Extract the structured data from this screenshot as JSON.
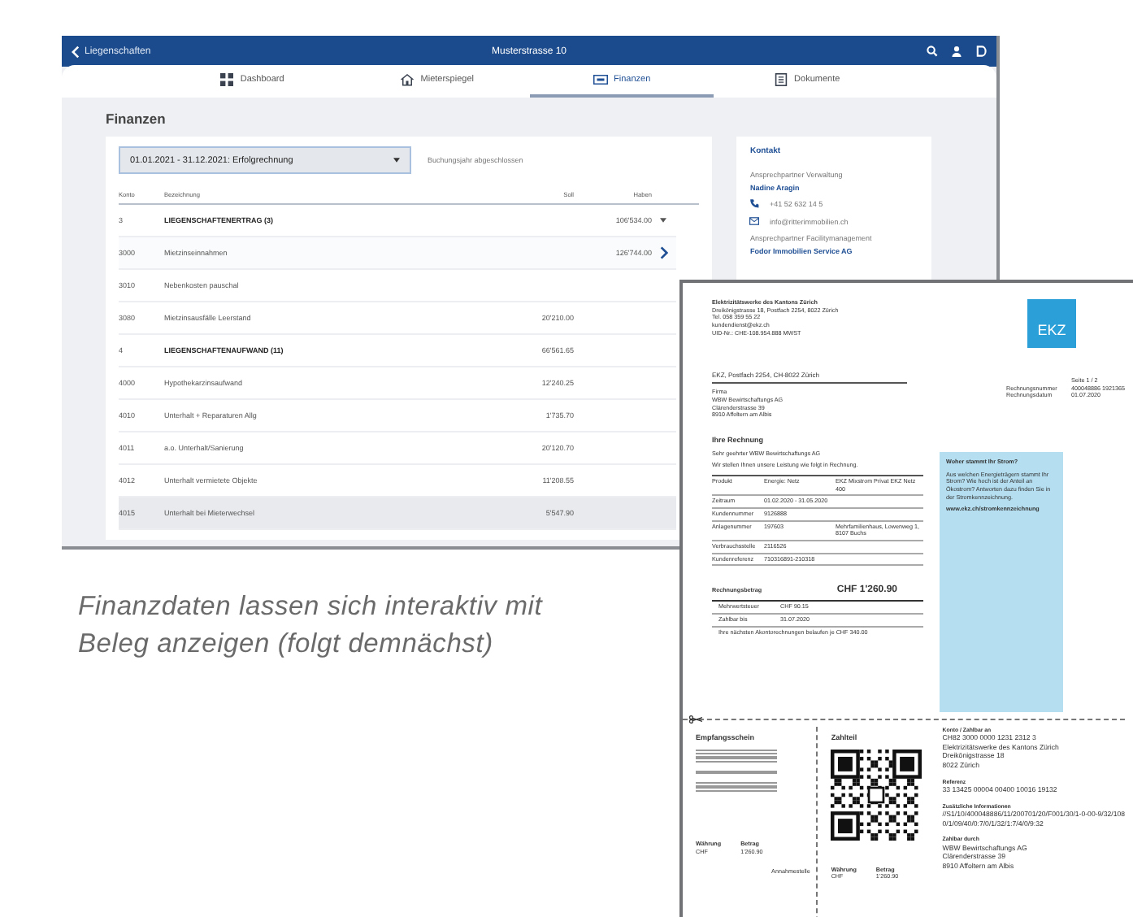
{
  "app": {
    "header": {
      "back_label": "Liegenschaften",
      "title": "Musterstrasse 10"
    },
    "tabs": [
      {
        "label": "Dashboard",
        "selected": false
      },
      {
        "label": "Mieterspiegel",
        "selected": false
      },
      {
        "label": "Finanzen",
        "selected": true
      },
      {
        "label": "Dokumente",
        "selected": false
      }
    ],
    "section_title": "Finanzen",
    "period_select": {
      "value": "01.01.2021 - 31.12.2021: Erfolgrechnung"
    },
    "period_status": "Buchungsjahr abgeschlossen",
    "table": {
      "columns": [
        "Konto",
        "Bezeichnung",
        "Soll",
        "Haben"
      ],
      "rows": [
        {
          "kind": "group",
          "konto": "3",
          "name": "LIEGENSCHAFTENERTRAG (3)",
          "soll": "",
          "haben": "106'534.00",
          "expanded": true,
          "selected": false,
          "hovered": false
        },
        {
          "kind": "account",
          "konto": "3000",
          "name": "Mietzinseinnahmen",
          "soll": "",
          "haben": "126'744.00",
          "selected": false,
          "hovered": true
        },
        {
          "kind": "account",
          "konto": "3010",
          "name": "Nebenkosten pauschal",
          "soll": "",
          "haben": "",
          "selected": false,
          "hovered": false
        },
        {
          "kind": "account",
          "konto": "3080",
          "name": "Mietzinsausfälle Leerstand",
          "soll": "20'210.00",
          "haben": "",
          "selected": false,
          "hovered": false
        },
        {
          "kind": "group",
          "konto": "4",
          "name": "LIEGENSCHAFTENAUFWAND (11)",
          "soll": "66'561.65",
          "haben": "",
          "selected": false,
          "hovered": false
        },
        {
          "kind": "account",
          "konto": "4000",
          "name": "Hypothekarzinsaufwand",
          "soll": "12'240.25",
          "haben": "",
          "selected": false,
          "hovered": false
        },
        {
          "kind": "account",
          "konto": "4010",
          "name": "Unterhalt + Reparaturen Allg",
          "soll": "1'735.70",
          "haben": "",
          "selected": false,
          "hovered": false
        },
        {
          "kind": "account",
          "konto": "4011",
          "name": "a.o. Unterhalt/Sanierung",
          "soll": "20'120.70",
          "haben": "",
          "selected": false,
          "hovered": false
        },
        {
          "kind": "account",
          "konto": "4012",
          "name": "Unterhalt vermietete Objekte",
          "soll": "11'208.55",
          "haben": "",
          "selected": false,
          "hovered": false
        },
        {
          "kind": "account",
          "konto": "4015",
          "name": "Unterhalt bei Mieterwechsel",
          "soll": "5'547.90",
          "haben": "",
          "selected": true,
          "hovered": false
        }
      ]
    },
    "contact": {
      "title": "Kontakt",
      "groups": [
        {
          "role": "Ansprechpartner Verwaltung",
          "name": "Nadine Aragin",
          "phone": "+41 52 632 14 5",
          "email": "info@ritterimmobilien.ch"
        },
        {
          "role": "Ansprechpartner Facilitymanagement",
          "name": "Fodor Immobilien Service AG"
        }
      ]
    }
  },
  "caption": "Finanzdaten lassen sich interaktiv mit Beleg anzeigen (folgt demnächst)",
  "invoice": {
    "sender": [
      "Elektrizitätswerke des Kantons Zürich",
      "Dreikönigstrasse 18, Postfach 2254, 8022 Zürich",
      "Tel. 058 359 55 22",
      "kundendienst@ekz.ch",
      "UID-Nr.: CHE-108.954.888 MWST"
    ],
    "logo": "EKZ",
    "return_address": "EKZ, Postfach 2254, CH-8022 Zürich",
    "recipient": [
      "Firma",
      "WBW Bewirtschaftungs AG",
      "Clärenderstrasse 39",
      "8910 Affoltern am Albis"
    ],
    "meta": [
      {
        "value": "Seite 1 / 2"
      },
      {
        "label": "Rechnungsnummer",
        "value": "400048886 1921365"
      },
      {
        "label": "Rechnungsdatum",
        "value": "01.07.2020"
      }
    ],
    "heading": "Ihre Rechnung",
    "salutation": "Sehr geehrter WBW Bewirtschaftungs AG",
    "intro": "Wir stellen Ihnen unsere Leistung wie folgt in Rechnung.",
    "details": [
      {
        "label": "Produkt",
        "value": "Energie: Netz",
        "extra": "EKZ Mixstrom Privat EKZ Netz 400"
      },
      {
        "label": "Zeitraum",
        "value": "01.02.2020 - 31.05.2020"
      },
      {
        "label": "Kundennummer",
        "value": "9126888"
      },
      {
        "label": "Anlagenummer",
        "value": "197603",
        "extra": "Mehrfamilienhaus, Lowenweg 1, 8107 Buchs"
      },
      {
        "label": "Verbrauchsstelle",
        "value": "2116526"
      },
      {
        "label": "Kundenreferenz",
        "value": "710316891-210318"
      }
    ],
    "info_box": {
      "title": "Woher stammt Ihr Strom?",
      "text": "Aus welchen Energieträgern stammt Ihr Strom? Wie hoch ist der Anteil an Ökostrom? Antworten dazu finden Sie in der Stromkennzeichnung.",
      "link": "www.ekz.ch/stromkennzeichnung"
    },
    "total_label": "Rechnungsbetrag",
    "total": "CHF 1'260.90",
    "summary": [
      {
        "label": "Mehrwertsteuer",
        "value": "CHF 90.15"
      },
      {
        "label": "Zahlbar bis",
        "value": "31.07.2020"
      }
    ],
    "note": "Ihre nächsten Akontorechnungen belaufen je CHF 340.00",
    "receipt": {
      "title": "Empfangsschein",
      "currency_label": "Währung",
      "amount_label": "Betrag",
      "currency": "CHF",
      "amount": "1'260.90",
      "acceptance": "Annahmestelle"
    },
    "payment": {
      "title": "Zahlteil",
      "currency_label": "Währung",
      "amount_label": "Betrag",
      "currency": "CHF",
      "amount": "1'260.90",
      "blocks": [
        {
          "label": "Konto / Zahlbar an",
          "lines": [
            "CH82 3000 0000 1231 2312 3",
            "Elektrizitätswerke des Kantons Zürich",
            "Dreikönigstrasse 18",
            "8022 Zürich"
          ]
        },
        {
          "label": "Referenz",
          "lines": [
            "33 13425 00004 00400 10016 19132"
          ]
        },
        {
          "label": "Zusätzliche Informationen",
          "lines": [
            "//S1/10/400048886/11/200701/20/F001/30/1-0-00-9/32/108",
            "0/1/09/40/0:7/0/1/32/1:7/4/0/9:32"
          ]
        },
        {
          "label": "Zahlbar durch",
          "lines": [
            "WBW Bewirtschaftungs AG",
            "Clärenderstrasse 39",
            "8910 Affoltern am Albis"
          ]
        }
      ]
    }
  }
}
